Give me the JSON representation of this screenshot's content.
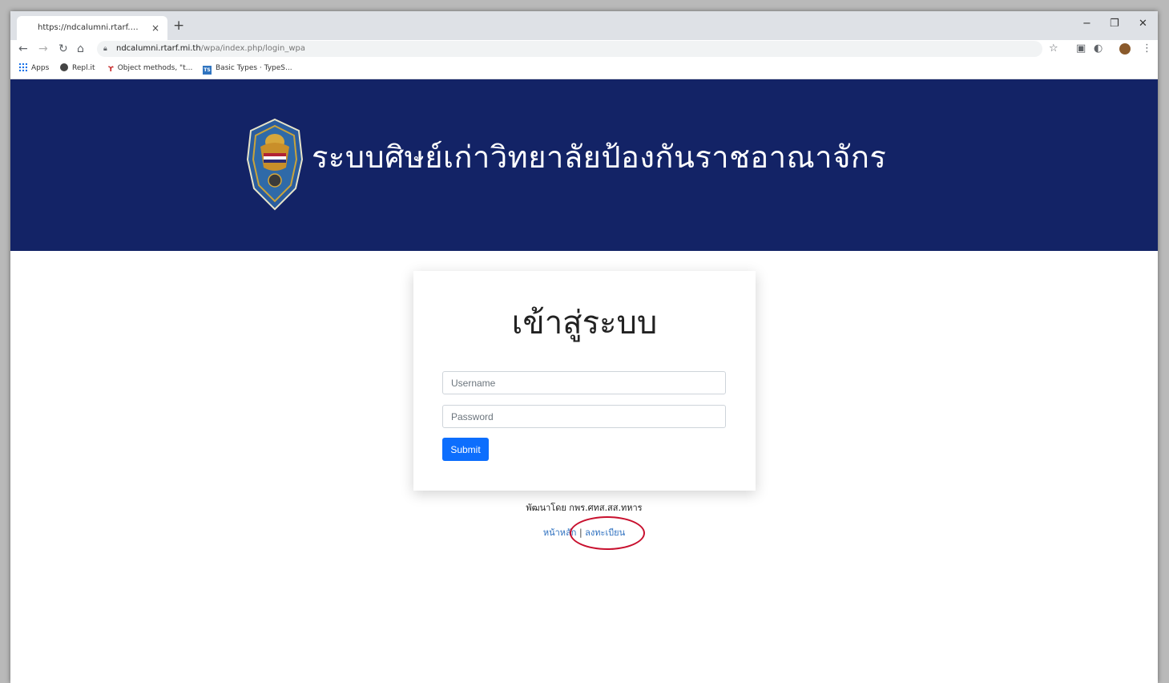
{
  "browser": {
    "tab_title": "https://ndcalumni.rtarf.mi.th/wpa",
    "tab_close": "×",
    "new_tab": "+",
    "url_host": "ndcalumni.rtarf.mi.th",
    "url_path": "/wpa/index.php/login_wpa",
    "window_controls": {
      "minimize": "−",
      "restore": "❐",
      "close": "✕"
    },
    "bookmarks": [
      {
        "label": "Apps",
        "icon": "apps-grid-icon"
      },
      {
        "label": "Repl.it",
        "icon": "replit-icon"
      },
      {
        "label": "Object methods, \"t...",
        "icon": "object-methods-icon"
      },
      {
        "label": "Basic Types · TypeS...",
        "icon": "typescript-icon"
      }
    ]
  },
  "header": {
    "site_title": "ระบบศิษย์เก่าวิทยาลัยป้องกันราชอาณาจักร",
    "banner_color": "#132366"
  },
  "login": {
    "heading": "เข้าสู่ระบบ",
    "username_placeholder": "Username",
    "password_placeholder": "Password",
    "submit_label": "Submit",
    "submit_color": "#0d6efd"
  },
  "footer": {
    "credit": "พัฒนาโดย กพร.ศทส.สส.ทหาร",
    "home_link": "หน้าหลัก",
    "separator": "|",
    "register_link": "ลงทะเบียน"
  }
}
